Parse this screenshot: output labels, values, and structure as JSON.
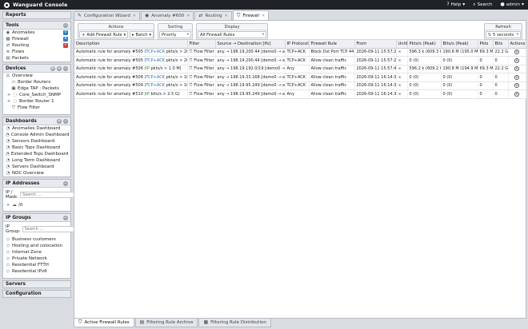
{
  "topbar": {
    "brand": "Wanguard Console",
    "help": "Help",
    "search": "Search",
    "user": "admin"
  },
  "sidebar": {
    "reports": "Reports",
    "tools": {
      "title": "Tools",
      "items": [
        {
          "label": "Anomalies",
          "badge": "0",
          "color": "#2f7fc1"
        },
        {
          "label": "Firewall",
          "badge": "8",
          "color": "#2f7fc1"
        },
        {
          "label": "Routing",
          "badge": "2",
          "color": "#d04040"
        },
        {
          "label": "Flows"
        },
        {
          "label": "Packets"
        }
      ]
    },
    "devices": {
      "title": "Devices",
      "items": [
        "Overview",
        "Border Routers",
        "Edge TAP : Packets",
        "Core_Switch_SNMP",
        "Border Router 1",
        "Flow Filter"
      ]
    },
    "dashboards": {
      "title": "Dashboards",
      "items": [
        "Anomalies Dashboard",
        "Console Admin Dashboard",
        "Sensors Dashboard",
        "Basic Tops Dashboard",
        "Extended Tops Dashboard",
        "Long Term Dashboard",
        "Servers Dashboard",
        "NOC Overview"
      ]
    },
    "ip_addresses": {
      "title": "IP Addresses",
      "label": "IP / Mask:",
      "placeholder": "Search ...",
      "tree": "/0"
    },
    "ip_groups": {
      "title": "IP Groups",
      "label": "IP Group:",
      "placeholder": "Search ...",
      "items": [
        "Business customers",
        "Hosting and colocation",
        "Internal Zone",
        "Private Network",
        "Residential FTTH",
        "Residential IPv6"
      ]
    },
    "servers": "Servers",
    "configuration": "Configuration"
  },
  "tabs": [
    {
      "label": "Configuration Wizard"
    },
    {
      "label": "Anomaly #600"
    },
    {
      "label": "Routing"
    },
    {
      "label": "Firewall"
    }
  ],
  "toolbar": {
    "actions": "Actions",
    "add_rule": "Add Firewall Rule",
    "batch": "Batch",
    "sorting": "Sorting",
    "sorting_value": "Priority",
    "display": "Display",
    "display_value": "All Firewall Rules",
    "refresh": "Refresh",
    "refresh_value": "5 seconds"
  },
  "table": {
    "columns": [
      "Description",
      "Filter",
      "Source → Destination [Ifs]",
      "IP Protocol",
      "Firewall Rule",
      "From",
      "Until",
      "Pkts/s (Peak)",
      "Bits/s (Peak)",
      "Pkts",
      "Bits",
      "Actions"
    ],
    "rows": [
      {
        "d1": "Automatic rule for anomaly #505 (",
        "p": "TCP+ACK",
        "d2": " pkts/s > 20.0 k)",
        "filter": "Flow Filter",
        "src": "any → 198.19.200.44 [demo0 → any]",
        "proto": "TCP+ACK",
        "rule": "Block Dst Port TCP 443",
        "from": "2026-09-11 15:57:25",
        "until": "∞",
        "pps": "596.3 k (609.3 k)",
        "bps": "190.8 M (195.0 M)",
        "pkts": "69.3 M",
        "bits": "22.2 G"
      },
      {
        "d1": "Automatic rule for anomaly #505 (",
        "p": "TCP+ACK",
        "d2": " pkts/s > 20.0 k)",
        "filter": "Flow Filter",
        "src": "any → 198.19.200.44 [demo0 → any]",
        "proto": "TCP+ACK",
        "rule": "Allow clean traffic",
        "from": "2026-09-11 15:57:25",
        "until": "∞",
        "pps": "0 (0)",
        "bps": "0 (0)",
        "pkts": "0",
        "bits": "0"
      },
      {
        "d1": "Automatic rule for anomaly #506 (",
        "p": "IP",
        "d2": " pkts/s > 1.0 M)",
        "filter": "Flow Filter",
        "src": "any → 198.19.192.0/19 [demo0 → any]",
        "proto": "Any",
        "rule": "Allow clean traffic",
        "from": "2026-09-11 15:57:45",
        "until": "∞",
        "pps": "596.2 k (609.2 k)",
        "bps": "190.8 M (194.9 M)",
        "pkts": "69.3 M",
        "bits": "22.2 G"
      },
      {
        "d1": "Automatic rule for anomaly #508 (",
        "p": "TCP+ACK",
        "d2": " pkts/s > 100.0 k)",
        "filter": "Flow Filter",
        "src": "any → 198.19.33.168 [demo0 → any]",
        "proto": "TCP+ACK",
        "rule": "Allow clean traffic",
        "from": "2026-09-11 16:14:35",
        "until": "∞",
        "pps": "0 (0)",
        "bps": "0 (0)",
        "pkts": "0",
        "bits": "0"
      },
      {
        "d1": "Automatic rule for anomaly #509 (",
        "p": "TCP+ACK",
        "d2": " pkts/s > 100.0 k)",
        "filter": "Flow Filter",
        "src": "any → 198.19.95.249 [demo0 → any]",
        "proto": "TCP+ACK",
        "rule": "Allow clean traffic",
        "from": "2026-09-11 16:14:35",
        "until": "∞",
        "pps": "0 (0)",
        "bps": "0 (0)",
        "pkts": "0",
        "bits": "0"
      },
      {
        "d1": "Automatic rule for anomaly #510 (",
        "p": "IP",
        "d2": " bits/s > 2.5 G)",
        "filter": "Flow Filter",
        "src": "any → 198.19.95.249 [demo0 → any]",
        "proto": "Any",
        "rule": "Allow clean traffic",
        "from": "2026-09-11 16:14:35",
        "until": "∞",
        "pps": "0 (0)",
        "bps": "0 (0)",
        "pkts": "0",
        "bits": "0"
      }
    ]
  },
  "bottom_tabs": [
    "Active Firewall Rules",
    "Filtering Rule Archive",
    "Filtering Rule Distribution"
  ]
}
